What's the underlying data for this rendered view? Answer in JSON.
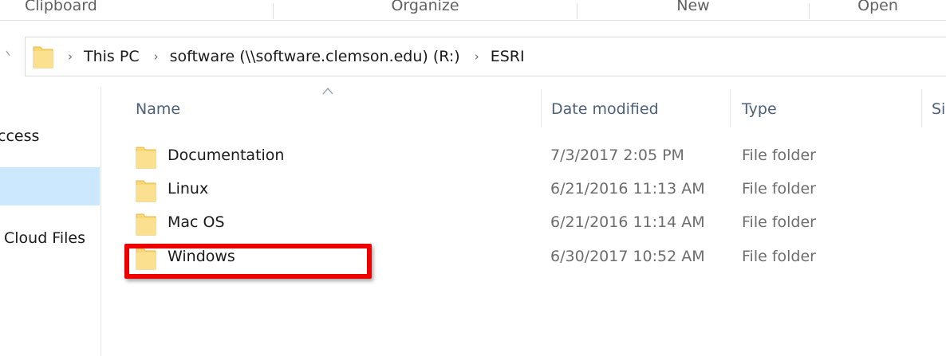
{
  "ribbon": {
    "groups": [
      "Clipboard",
      "Organize",
      "New",
      "Open"
    ]
  },
  "address_bar": {
    "crumbs": [
      "This PC",
      "software (\\\\software.clemson.edu) (R:)",
      "ESRI"
    ],
    "folder_icon": "folder-icon"
  },
  "nav_pane": {
    "items": [
      "ccess",
      "",
      "Cloud Files"
    ]
  },
  "columns": {
    "name": "Name",
    "date_modified": "Date modified",
    "type": "Type",
    "size": "Si"
  },
  "files": [
    {
      "name": "Documentation",
      "date": "7/3/2017 2:05 PM",
      "type": "File folder"
    },
    {
      "name": "Linux",
      "date": "6/21/2016 11:13 AM",
      "type": "File folder"
    },
    {
      "name": "Mac OS",
      "date": "6/21/2016 11:14 AM",
      "type": "File folder"
    },
    {
      "name": "Windows",
      "date": "6/30/2017 10:52 AM",
      "type": "File folder"
    }
  ],
  "colors": {
    "highlight": "#ee0000",
    "folder": "#f8d775",
    "selection": "#cce8ff"
  }
}
